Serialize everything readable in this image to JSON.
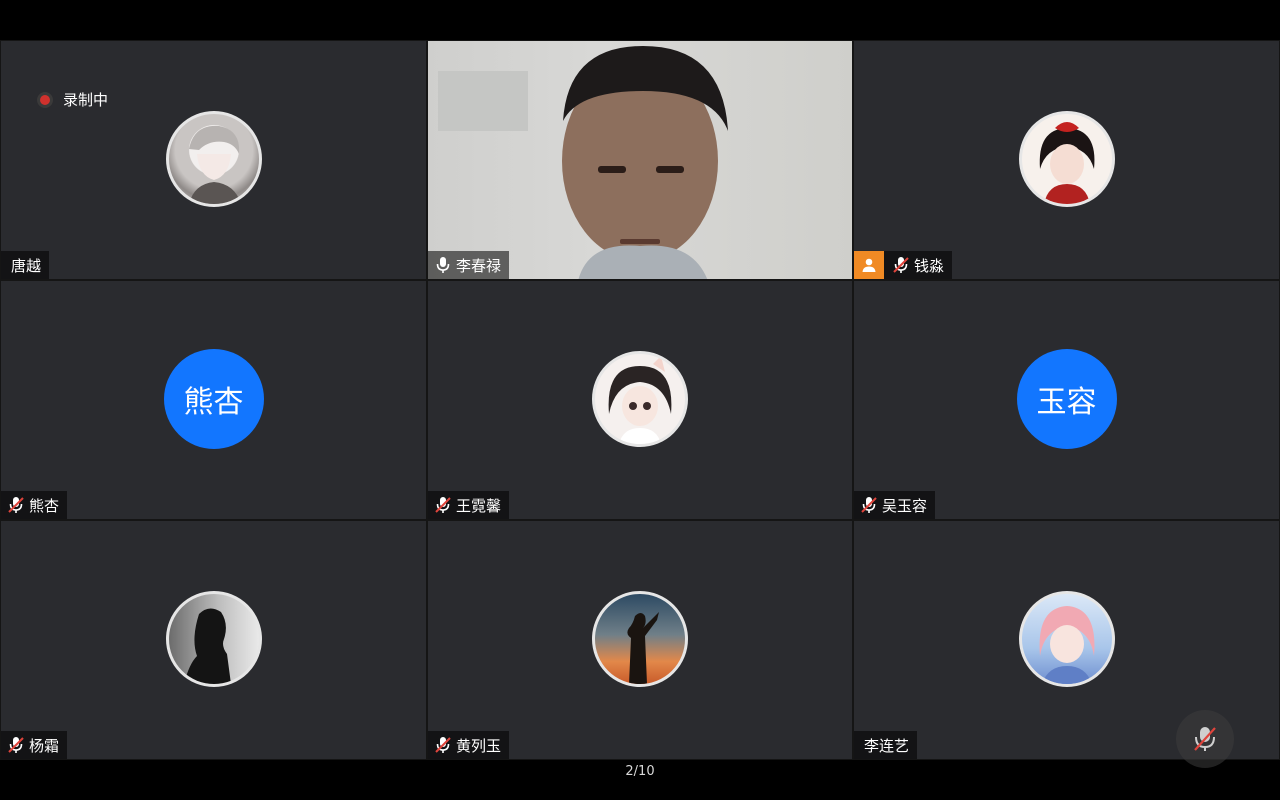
{
  "recording": {
    "label": "录制中"
  },
  "participants": [
    {
      "name": "唐越",
      "mic": "none",
      "avatar": "avatar-illustration-boy"
    },
    {
      "name": "李春禄",
      "mic": "on",
      "video": true
    },
    {
      "name": "钱淼",
      "mic": "muted",
      "host": true,
      "avatar": "avatar-illustration-girl-red"
    },
    {
      "name": "熊杏",
      "mic": "muted",
      "avatar_text": "熊杏",
      "avatar_color": "#1276ff"
    },
    {
      "name": "王霓馨",
      "mic": "muted",
      "avatar": "avatar-illustration-cat-girl"
    },
    {
      "name": "吴玉容",
      "mic": "muted",
      "avatar_text": "玉容",
      "avatar_color": "#1276ff"
    },
    {
      "name": "杨霜",
      "mic": "muted",
      "avatar": "avatar-photo-silhouette"
    },
    {
      "name": "黄列玉",
      "mic": "muted",
      "avatar": "avatar-photo-sunset"
    },
    {
      "name": "李连艺",
      "mic": "none",
      "avatar": "avatar-illustration-pink-hair"
    }
  ],
  "pagination": {
    "text": "2/10"
  },
  "controls": {
    "mute_icon": "mic-muted-icon"
  },
  "colors": {
    "accent": "#1276ff",
    "host_badge": "#f08a24",
    "recording": "#d0312d",
    "tile_bg": "#2a2b2f"
  }
}
